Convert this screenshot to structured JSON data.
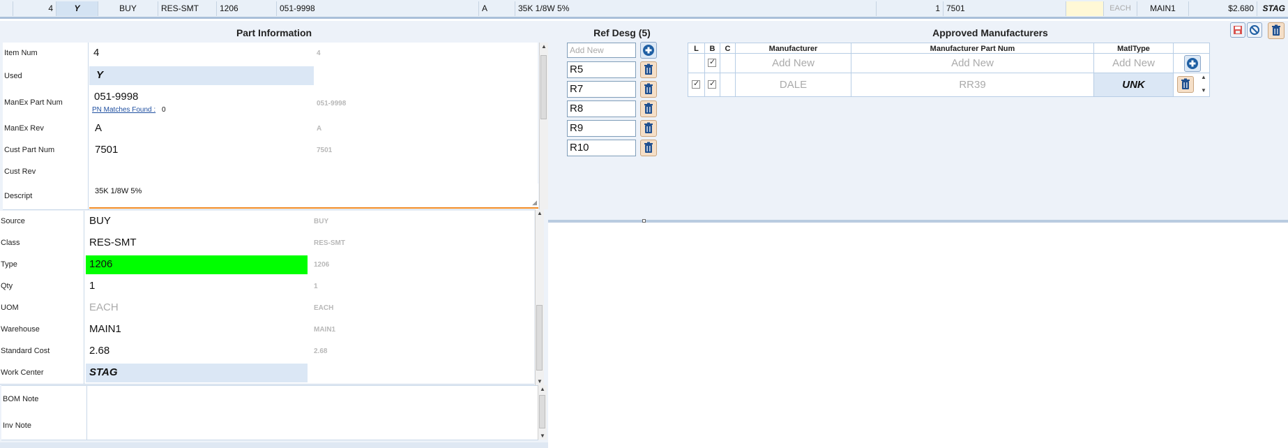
{
  "top_row": {
    "item_num": "4",
    "used": "Y",
    "source": "BUY",
    "class": "RES-SMT",
    "type": "1206",
    "part_num": "051-9998",
    "rev": "A",
    "descript": "35K 1/8W 5%",
    "qty": "1",
    "cust_part": "7501",
    "uom": "EACH",
    "warehouse": "MAIN1",
    "cost": "$2.680",
    "work_center": "STAG"
  },
  "part_info": {
    "title": "Part Information",
    "fields": {
      "item_num": {
        "label": "Item Num",
        "value": "4",
        "orig": "4"
      },
      "used": {
        "label": "Used",
        "value": "Y"
      },
      "manex_part_num": {
        "label": "ManEx Part Num",
        "value": "051-9998",
        "orig": "051-9998",
        "matches_link": "PN Matches Found :",
        "matches_count": "0"
      },
      "manex_rev": {
        "label": "ManEx Rev",
        "value": "A",
        "orig": "A"
      },
      "cust_part_num": {
        "label": "Cust Part Num",
        "value": "7501",
        "orig": "7501"
      },
      "cust_rev": {
        "label": "Cust Rev",
        "value": ""
      },
      "descript": {
        "label": "Descript",
        "value": "35K 1/8W 5%"
      },
      "source": {
        "label": "Source",
        "value": "BUY",
        "orig": "BUY"
      },
      "class": {
        "label": "Class",
        "value": "RES-SMT",
        "orig": "RES-SMT"
      },
      "type": {
        "label": "Type",
        "value": "1206",
        "orig": "1206",
        "highlight": "#00ff00"
      },
      "qty": {
        "label": "Qty",
        "value": "1",
        "orig": "1"
      },
      "uom": {
        "label": "UOM",
        "value": "EACH",
        "orig": "EACH"
      },
      "warehouse": {
        "label": "Warehouse",
        "value": "MAIN1",
        "orig": "MAIN1"
      },
      "standard_cost": {
        "label": "Standard Cost",
        "value": "2.68",
        "orig": "2.68"
      },
      "work_center": {
        "label": "Work Center",
        "value": "STAG"
      },
      "bom_note": {
        "label": "BOM Note",
        "value": ""
      },
      "inv_note": {
        "label": "Inv Note",
        "value": ""
      }
    }
  },
  "ref_desg": {
    "title": "Ref Desg (5)",
    "placeholder": "Add New",
    "items": [
      "R5",
      "R7",
      "R8",
      "R9",
      "R10"
    ]
  },
  "approved_mfr": {
    "title": "Approved Manufacturers",
    "headers": {
      "l": "L",
      "b": "B",
      "c": "C",
      "manufacturer": "Manufacturer",
      "mfr_part_num": "Manufacturer Part Num",
      "matl_type": "MatlType"
    },
    "add_new": "Add New",
    "rows": [
      {
        "l": true,
        "b": true,
        "c": false,
        "manufacturer": "DALE",
        "mfr_part_num": "RR39",
        "matl_type": "UNK"
      }
    ]
  },
  "toolbar": {
    "icons": [
      "save-icon",
      "cancel-icon",
      "delete-icon"
    ]
  },
  "colors": {
    "accent": "#1f5fa3",
    "panel_bg": "#edf2f9",
    "highlight_green": "#00ff00",
    "trash_bg": "#f5dfc8"
  }
}
